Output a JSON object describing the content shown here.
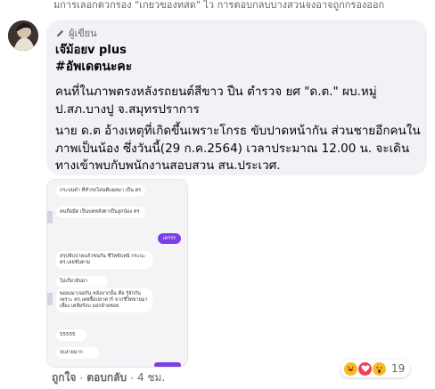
{
  "snippet_top": "มการเลอกตวกรอง \"เกยวของทสด\" ไว การตอบกลบบางสวนจงอาจถูกกรองออก",
  "comment": {
    "badge_label": "ผู้เขียน",
    "author": "เจ๊ม้อยv plus",
    "hashtag": "#อัพเดตนะคะ",
    "paragraph_1": "คนที่ในภาพตรงหลังรถยนต์สีขาว ปืน ตำรวจ ยศ \"ด.ต.\" ผบ.หมู่ ป.สภ.บางปู จ.สมุทรปราการ",
    "paragraph_2": "นาย ด.ต อ้างเหตุที่เกิดขึ้นเพราะโกรธ ขับปาดหน้ากัน ส่วนชายอีกคนในภาพเป็นน้อง ซึ่งวันนี้(29 ก.ค.2564) เวลาประมาณ 12.00 น. จะเดินทางเข้าพบกับพนักงานสอบสวน สน.ประเวศ."
  },
  "attachment": {
    "messages": [
      "กระบบดำ ที่หัวรถโดนตีแผลมา เป็น ตร",
      "คนถือมีด เป็นบคหลังตาเป็นลูกน้อง ตร",
      "สรุปขับปาดแล้วชนกัน ชีวิตขับหนี กระบะตร.เลยขับตาม",
      "ไม่เกี่ยวจับยา",
      "พอลงมาเจอกัน หลังจากนั้น คือ รู้จักกัน เพราะ ตร.เคยซื้อปลาคาร์ จากชีวิตขายมาเลี้ยง เคลียร์จบ แยกย้ายซอย",
      "55555",
      "จบง่ายมาก"
    ],
    "outgoing_label": "เครรร"
  },
  "actions": {
    "like": "ถูกใจ",
    "sep1": "·",
    "reply": "ตอบกลับ",
    "sep2": "·",
    "time": "4 ชม."
  },
  "reactions": {
    "icons": [
      "haha-icon",
      "love-icon",
      "wow-icon"
    ],
    "count": "19",
    "colors": {
      "haha": "#f7b928",
      "love": "#f33e58",
      "wow": "#f7b928"
    }
  }
}
